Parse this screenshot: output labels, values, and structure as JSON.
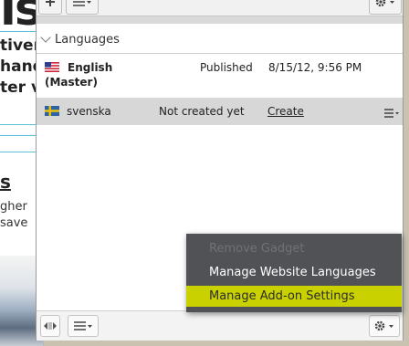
{
  "background_page": {
    "big_heading": "is",
    "lines": [
      "tiver",
      "hand",
      "ter v"
    ],
    "subheading": "s",
    "small_lines": [
      "gher",
      "save"
    ]
  },
  "languages": {
    "section_title": "Languages",
    "rows": [
      {
        "flag": "us-flag",
        "name": "English",
        "role": "(Master)",
        "status": "Published",
        "date": "8/15/12, 9:56 PM",
        "action": ""
      },
      {
        "flag": "se-flag",
        "name": "svenska",
        "role": "",
        "status": "Not created yet",
        "date": "",
        "action": "Create"
      }
    ]
  },
  "menu": {
    "items": [
      {
        "label": "Remove Gadget",
        "state": "disabled"
      },
      {
        "label": "Manage Website Languages",
        "state": "normal"
      },
      {
        "label": "Manage Add-on Settings",
        "state": "highlighted"
      }
    ]
  },
  "colors": {
    "menu_bg": "#505256",
    "highlight": "#c9d200",
    "selected_row": "#d7d7d7"
  }
}
